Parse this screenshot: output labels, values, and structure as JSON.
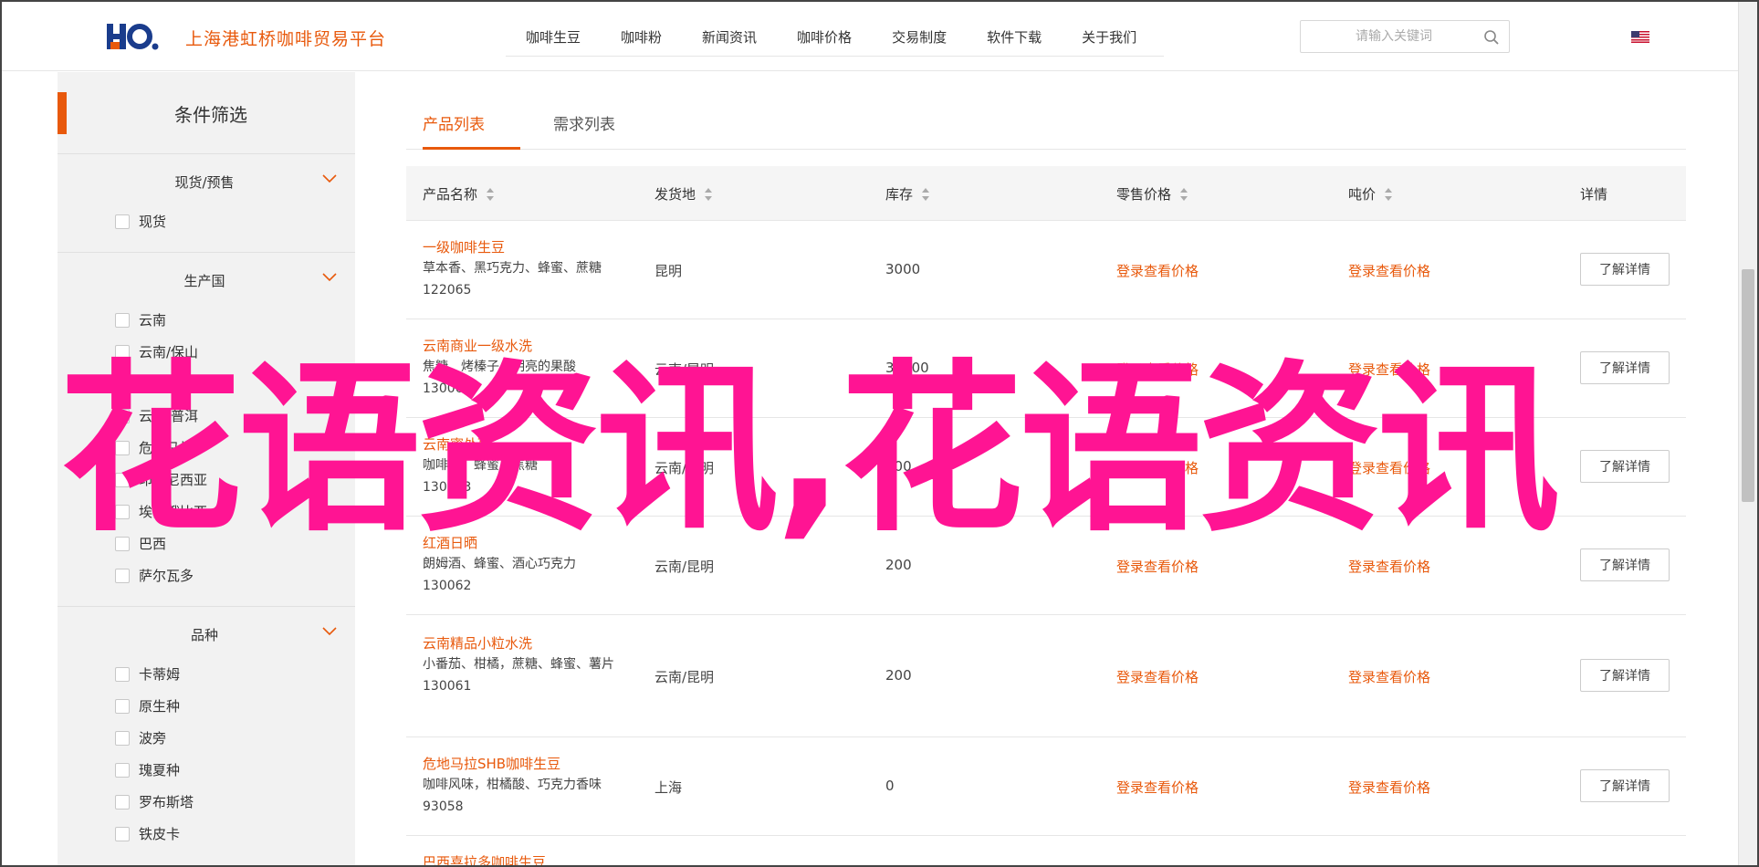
{
  "header": {
    "logo_alt": "HO",
    "site_name": "上海港虹桥咖啡贸易平台",
    "nav": [
      "咖啡生豆",
      "咖啡粉",
      "新闻资讯",
      "咖啡价格",
      "交易制度",
      "软件下载",
      "关于我们"
    ],
    "search_placeholder": "请输入关键词",
    "language_icon": "us-flag-icon"
  },
  "sidebar": {
    "title": "条件筛选",
    "groups": [
      {
        "title": "现货/预售",
        "options": [
          "现货"
        ]
      },
      {
        "title": "生产国",
        "options": [
          "云南",
          "云南/保山",
          "云南/思茅",
          "云南/普洱",
          "危地马拉",
          "印度尼西亚",
          "埃塞俄比亚",
          "巴西",
          "萨尔瓦多"
        ]
      },
      {
        "title": "品种",
        "options": [
          "卡蒂姆",
          "原生种",
          "波旁",
          "瑰夏种",
          "罗布斯塔",
          "铁皮卡"
        ]
      }
    ]
  },
  "tabs": [
    "产品列表",
    "需求列表"
  ],
  "table": {
    "headers": [
      "产品名称",
      "发货地",
      "库存",
      "零售价格",
      "吨价",
      "详情"
    ],
    "rows": [
      {
        "name": "一级咖啡生豆",
        "desc": "草本香、黑巧克力、蜂蜜、蔗糖",
        "code": "122065",
        "origin": "昆明",
        "stock": "3000",
        "retail": "登录查看价格",
        "ton": "登录查看价格",
        "detail": "了解详情"
      },
      {
        "name": "云南商业一级水洗",
        "desc": "焦糖、烤榛子，明亮的果酸",
        "code": "130064",
        "origin": "云南/昆明",
        "stock": "30000",
        "retail": "登录查看价格",
        "ton": "登录查看价格",
        "detail": "了解详情"
      },
      {
        "name": "云南蜜处理",
        "desc": "咖啡花、蜂蜜、焦糖",
        "code": "130063",
        "origin": "云南/昆明",
        "stock": "200",
        "retail": "登录查看价格",
        "ton": "登录查看价格",
        "detail": "了解详情"
      },
      {
        "name": "红酒日晒",
        "desc": "朗姆酒、蜂蜜、酒心巧克力",
        "code": "130062",
        "origin": "云南/昆明",
        "stock": "200",
        "retail": "登录查看价格",
        "ton": "登录查看价格",
        "detail": "了解详情"
      },
      {
        "name": "云南精品小粒水洗",
        "desc": "小番茄、柑橘，蔗糖、蜂蜜、薯片",
        "code": "130061",
        "origin": "云南/昆明",
        "stock": "200",
        "retail": "登录查看价格",
        "ton": "登录查看价格",
        "detail": "了解详情"
      },
      {
        "name": "危地马拉SHB咖啡生豆",
        "desc": "咖啡风味，柑橘酸、巧克力香味",
        "code": "93058",
        "origin": "上海",
        "stock": "0",
        "retail": "登录查看价格",
        "ton": "登录查看价格",
        "detail": "了解详情"
      },
      {
        "name": "巴西喜拉多咖啡生豆",
        "desc": "",
        "code": "",
        "origin": "",
        "stock": "",
        "retail": "",
        "ton": "",
        "detail": ""
      }
    ]
  },
  "watermark": "花语资讯,花语资讯",
  "colors": {
    "accent": "#e8590c",
    "watermark": "#ff1493"
  }
}
